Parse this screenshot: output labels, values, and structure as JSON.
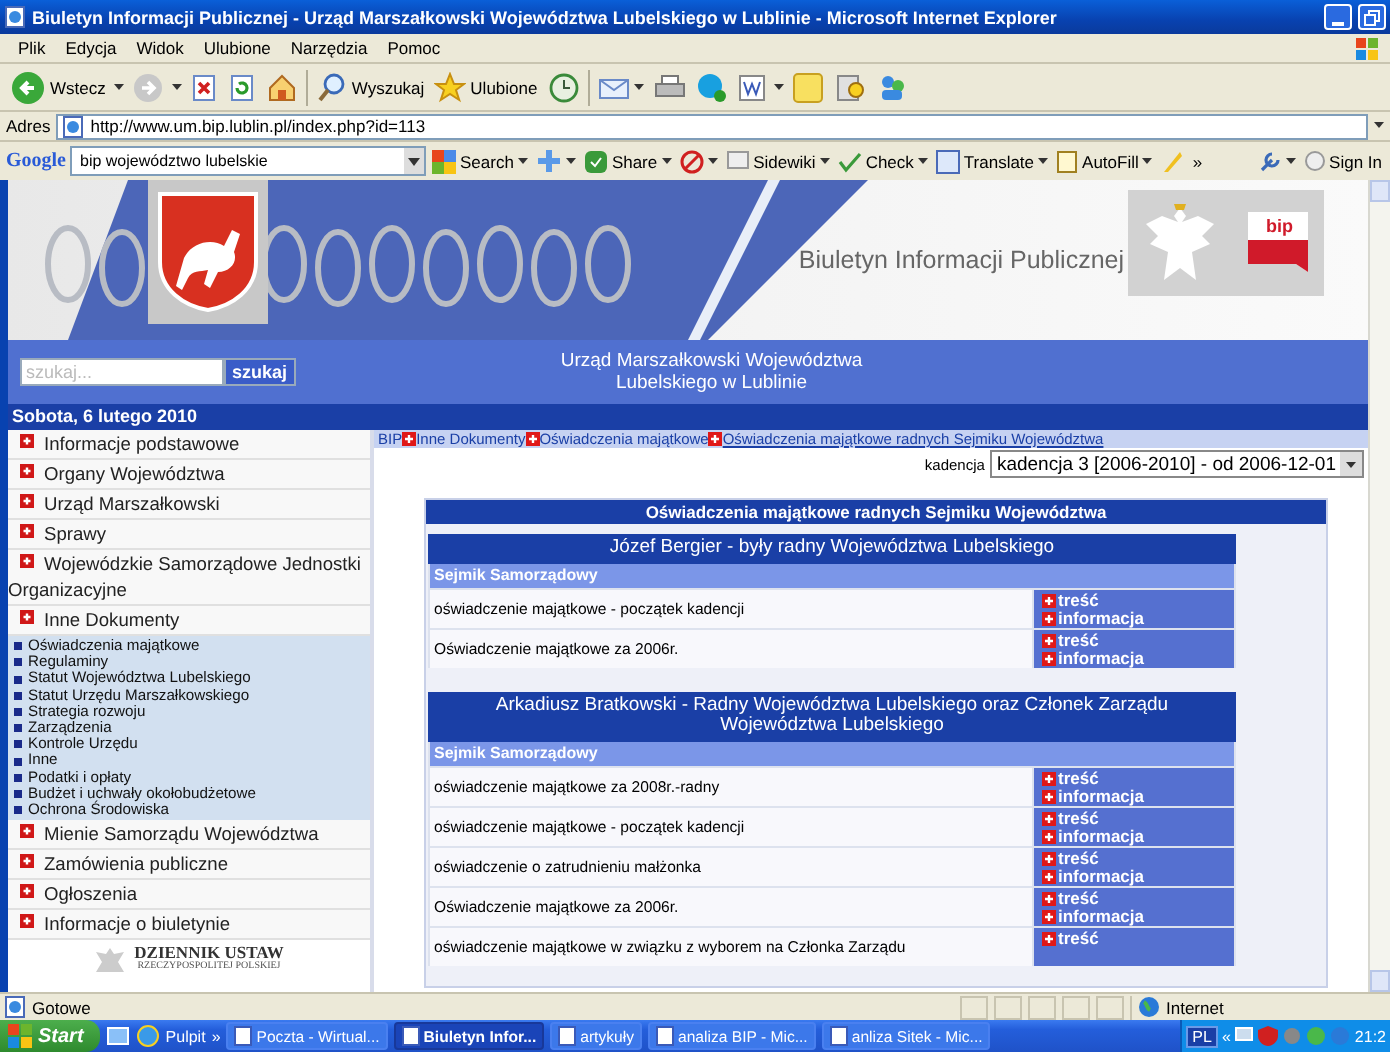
{
  "window": {
    "title": "Biuletyn Informacji Publicznej - Urząd Marszałkowski Województwa Lubelskiego w Lublinie - Microsoft Internet Explorer"
  },
  "menu": [
    "Plik",
    "Edycja",
    "Widok",
    "Ulubione",
    "Narzędzia",
    "Pomoc"
  ],
  "toolbar": {
    "back": "Wstecz",
    "search": "Wyszukaj",
    "favorites": "Ulubione"
  },
  "address": {
    "label": "Adres",
    "url": "http://www.um.bip.lublin.pl/index.php?id=113"
  },
  "google_bar": {
    "brand": "Google",
    "query": "bip województwo lubelskie",
    "search": "Search",
    "share": "Share",
    "sidewiki": "Sidewiki",
    "check": "Check",
    "translate": "Translate",
    "autofill": "AutoFill",
    "more": "»",
    "sign_in": "Sign In"
  },
  "banner": {
    "title": "Biuletyn Informacji Publicznej",
    "bip": "bip"
  },
  "site_search": {
    "placeholder": "szukaj...",
    "button": "szukaj"
  },
  "office": [
    "Urząd Marszałkowski Województwa",
    "Lubelskiego w Lublinie"
  ],
  "date": "Sobota, 6 lutego 2010",
  "sidebar": {
    "items": [
      {
        "label": "Informacje podstawowe"
      },
      {
        "label": "Organy Województwa"
      },
      {
        "label": "Urząd Marszałkowski"
      },
      {
        "label": "Sprawy"
      },
      {
        "label": "Wojewódzkie Samorządowe Jednostki Organizacyjne"
      },
      {
        "label": "Inne Dokumenty",
        "children": [
          {
            "label": "Oświadczenia majątkowe"
          },
          {
            "label": "Regulaminy"
          },
          {
            "label": "Statut Województwa Lubelskiego"
          },
          {
            "label": "Statut Urzędu Marszałkowskiego"
          },
          {
            "label": "Strategia rozwoju"
          },
          {
            "label": "Zarządzenia"
          },
          {
            "label": "Kontrole Urzędu"
          },
          {
            "label": "Inne"
          },
          {
            "label": "Podatki i opłaty"
          },
          {
            "label": "Budżet i uchwały okołobudżetowe"
          },
          {
            "label": "Ochrona Środowiska"
          }
        ]
      },
      {
        "label": "Mienie Samorządu Województwa"
      },
      {
        "label": "Zamówienia publiczne"
      },
      {
        "label": "Ogłoszenia"
      },
      {
        "label": "Informacje o biuletynie"
      }
    ],
    "logo": {
      "title": "DZIENNIK USTAW",
      "subtitle": "RZECZYPOSPOLITEJ POLSKIEJ"
    }
  },
  "breadcrumb": [
    "BIP",
    "Inne Dokumenty",
    "Oświadczenia majątkowe",
    "Oświadczenia majątkowe radnych Sejmiku Województwa"
  ],
  "term": {
    "label": "kadencja",
    "value": "kadencja 3 [2006-2010] - od 2006-12-01"
  },
  "declarations": {
    "title": "Oświadczenia majątkowe radnych Sejmiku Województwa",
    "people": [
      {
        "name": "Józef Bergier - były radny Województwa Lubelskiego",
        "section": "Sejmik Samorządowy",
        "rows": [
          {
            "label": "oświadczenie majątkowe - początek kadencji",
            "links": [
              "treść",
              "informacja"
            ]
          },
          {
            "label": "Oświadczenie majątkowe za 2006r.",
            "links": [
              "treść",
              "informacja"
            ]
          }
        ]
      },
      {
        "name": "Arkadiusz Bratkowski - Radny Województwa Lubelskiego oraz Członek Zarządu Województwa Lubelskiego",
        "section": "Sejmik Samorządowy",
        "rows": [
          {
            "label": "oświadczenie majątkowe za 2008r.-radny",
            "links": [
              "treść",
              "informacja"
            ]
          },
          {
            "label": "oświadczenie majątkowe - początek kadencji",
            "links": [
              "treść",
              "informacja"
            ]
          },
          {
            "label": "oświadczenie o zatrudnieniu małżonka",
            "links": [
              "treść",
              "informacja"
            ]
          },
          {
            "label": "Oświadczenie majątkowe za 2006r.",
            "links": [
              "treść",
              "informacja"
            ]
          },
          {
            "label": "oświadczenie majątkowe w związku z wyborem na Członka Zarządu",
            "links": [
              "treść"
            ]
          }
        ]
      }
    ]
  },
  "status_bar": {
    "text": "Gotowe",
    "zone": "Internet"
  },
  "taskbar": {
    "start": "Start",
    "desktop": "Pulpit",
    "more": "»",
    "tasks": [
      {
        "label": "Poczta - Wirtual...",
        "selected": false
      },
      {
        "label": "Biuletyn Infor...",
        "selected": true
      },
      {
        "label": "artykuły",
        "selected": false
      },
      {
        "label": "analiza BIP - Mic...",
        "selected": false
      },
      {
        "label": "anliza Sitek - Mic...",
        "selected": false
      }
    ],
    "language": "PL",
    "tray_more": "«",
    "clock": "21:2"
  }
}
